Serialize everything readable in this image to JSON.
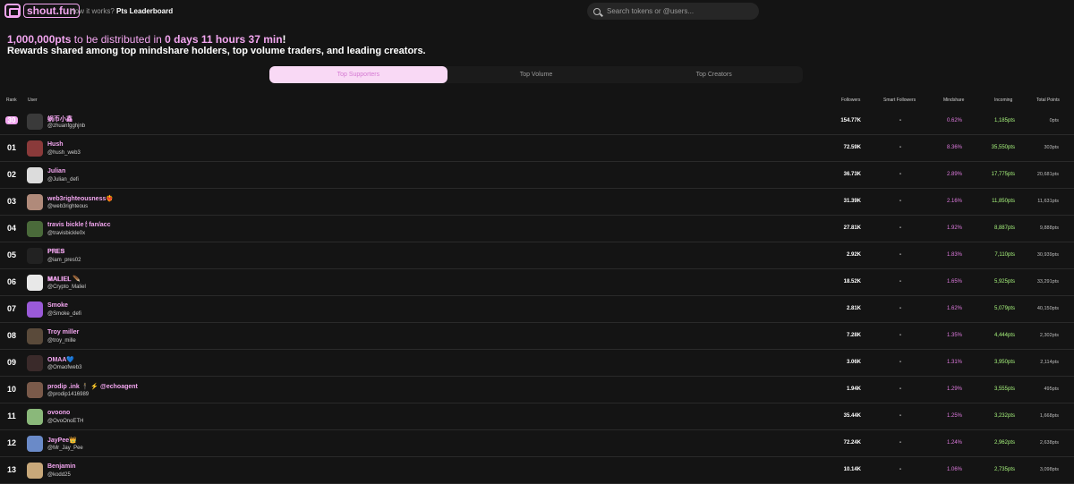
{
  "header": {
    "logo_text": "shout.fun",
    "nav": [
      {
        "label": "How it works?"
      },
      {
        "label": "Pts Leaderboard"
      }
    ],
    "search_placeholder": "Search tokens or @users..."
  },
  "promo": {
    "amount": "1,000,000pts",
    "mid_text": "to be distributed in",
    "time": "0 days 11 hours 37 min",
    "tail": "!",
    "subtitle": "Rewards shared among top mindshare holders, top volume traders, and leading creators."
  },
  "tabs": [
    "Top Supporters",
    "Top Volume",
    "Top Creators"
  ],
  "columns": {
    "rank": "Rank",
    "user": "User",
    "followers": "Followers",
    "smart": "Smart Followers",
    "mindshare": "Mindshare",
    "incoming": "Incoming",
    "total": "Total Points"
  },
  "rows": [
    {
      "rank": "30",
      "name": "蜗币小鑫",
      "handle": "@zhuanfgghjnb",
      "followers": "154.77K",
      "smart": "-",
      "mindshare": "0.62%",
      "incoming": "1,185pts",
      "total": "0pts",
      "color": "#3a3a3a"
    },
    {
      "rank": "01",
      "name": "Hush",
      "handle": "@hush_web3",
      "followers": "72.59K",
      "smart": "-",
      "mindshare": "8.36%",
      "incoming": "35,550pts",
      "total": "303pts",
      "color": "#8a3a3a"
    },
    {
      "rank": "02",
      "name": "Julian",
      "handle": "@Julian_defi",
      "followers": "36.73K",
      "smart": "-",
      "mindshare": "2.89%",
      "incoming": "17,775pts",
      "total": "20,681pts",
      "color": "#dcdcdc"
    },
    {
      "rank": "03",
      "name": "web3righteousness❤️‍🔥",
      "handle": "@web3righteous",
      "followers": "31.39K",
      "smart": "-",
      "mindshare": "2.16%",
      "incoming": "11,850pts",
      "total": "11,631pts",
      "color": "#b08a7a"
    },
    {
      "rank": "04",
      "name": "travis bickle 🕯 fan/acc",
      "handle": "@travisbickle0x",
      "followers": "27.81K",
      "smart": "-",
      "mindshare": "1.92%",
      "incoming": "8,887pts",
      "total": "9,888pts",
      "color": "#4a6a3a"
    },
    {
      "rank": "05",
      "name": "𝐏𝐑𝐄𝐒",
      "handle": "@iam_pres02",
      "followers": "2.92K",
      "smart": "-",
      "mindshare": "1.83%",
      "incoming": "7,110pts",
      "total": "30,939pts",
      "color": "#222222"
    },
    {
      "rank": "06",
      "name": "𝐌𝐀𝐋𝐈𝐄𝐋 🪶",
      "handle": "@Crypto_Maliel",
      "followers": "18.52K",
      "smart": "-",
      "mindshare": "1.65%",
      "incoming": "5,925pts",
      "total": "33,291pts",
      "color": "#e8e8e8"
    },
    {
      "rank": "07",
      "name": "Smoke",
      "handle": "@Smoke_defi",
      "followers": "2.81K",
      "smart": "-",
      "mindshare": "1.62%",
      "incoming": "5,079pts",
      "total": "40,150pts",
      "color": "#9a5ad8"
    },
    {
      "rank": "08",
      "name": "Troy miller",
      "handle": "@troy_mille",
      "followers": "7.28K",
      "smart": "-",
      "mindshare": "1.35%",
      "incoming": "4,444pts",
      "total": "2,302pts",
      "color": "#5a4a3a"
    },
    {
      "rank": "09",
      "name": "OMAA💙",
      "handle": "@Omaofweb3",
      "followers": "3.06K",
      "smart": "-",
      "mindshare": "1.31%",
      "incoming": "3,950pts",
      "total": "2,114pts",
      "color": "#3a2a2a"
    },
    {
      "rank": "10",
      "name": "prodip .ink 🕴 ⚡ @echoagent",
      "handle": "@prodip1416989",
      "followers": "1.94K",
      "smart": "-",
      "mindshare": "1.29%",
      "incoming": "3,555pts",
      "total": "495pts",
      "color": "#7a5a4a"
    },
    {
      "rank": "11",
      "name": "ovoono",
      "handle": "@OvoOnoETH",
      "followers": "35.44K",
      "smart": "-",
      "mindshare": "1.25%",
      "incoming": "3,232pts",
      "total": "1,668pts",
      "color": "#8ab87a"
    },
    {
      "rank": "12",
      "name": "JayPee👑",
      "handle": "@Mr_Jay_Pee",
      "followers": "72.24K",
      "smart": "-",
      "mindshare": "1.24%",
      "incoming": "2,962pts",
      "total": "2,638pts",
      "color": "#6a8ac8"
    },
    {
      "rank": "13",
      "name": "Benjamin",
      "handle": "@kodd25",
      "followers": "10.14K",
      "smart": "-",
      "mindshare": "1.06%",
      "incoming": "2,735pts",
      "total": "3,098pts",
      "color": "#c8a87a"
    }
  ]
}
